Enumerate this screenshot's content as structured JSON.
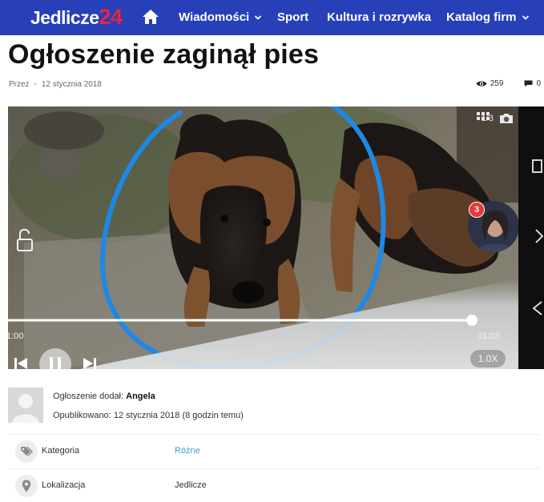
{
  "header": {
    "logo_text": "Jedlicze",
    "logo_number": "24",
    "home_icon": "home-icon",
    "nav": [
      {
        "label": "Wiadomości",
        "has_dropdown": true
      },
      {
        "label": "Sport",
        "has_dropdown": false
      },
      {
        "label": "Kultura i rozrywka",
        "has_dropdown": false
      },
      {
        "label": "Katalog firm",
        "has_dropdown": true
      }
    ],
    "colors": {
      "nav_bg": "#2740b8",
      "logo_accent": "#e8253d"
    }
  },
  "article": {
    "title": "Ogłoszenie zaginął pies",
    "by_label": "Przez",
    "separator": "-",
    "date": "12 stycznia 2018",
    "views": "259",
    "comments": "0"
  },
  "media": {
    "counter": "1/3",
    "time_start": "1:00",
    "time_end": "01:03",
    "speed": "1.0X",
    "notification_count": "3",
    "playback_progress": 0.93,
    "highlight_color": "#1e88e5"
  },
  "author": {
    "added_label": "Ogłoszenie dodał:",
    "name": "Angela",
    "published_label": "Opublikowano:",
    "published_value": "12 stycznia 2018 (8 godzin temu)"
  },
  "details": [
    {
      "label": "Kategoria",
      "value": "Różne",
      "icon": "tags-icon",
      "is_link": true
    },
    {
      "label": "Lokalizacja",
      "value": "Jedlicze",
      "icon": "map-pin-icon",
      "is_link": false
    }
  ]
}
